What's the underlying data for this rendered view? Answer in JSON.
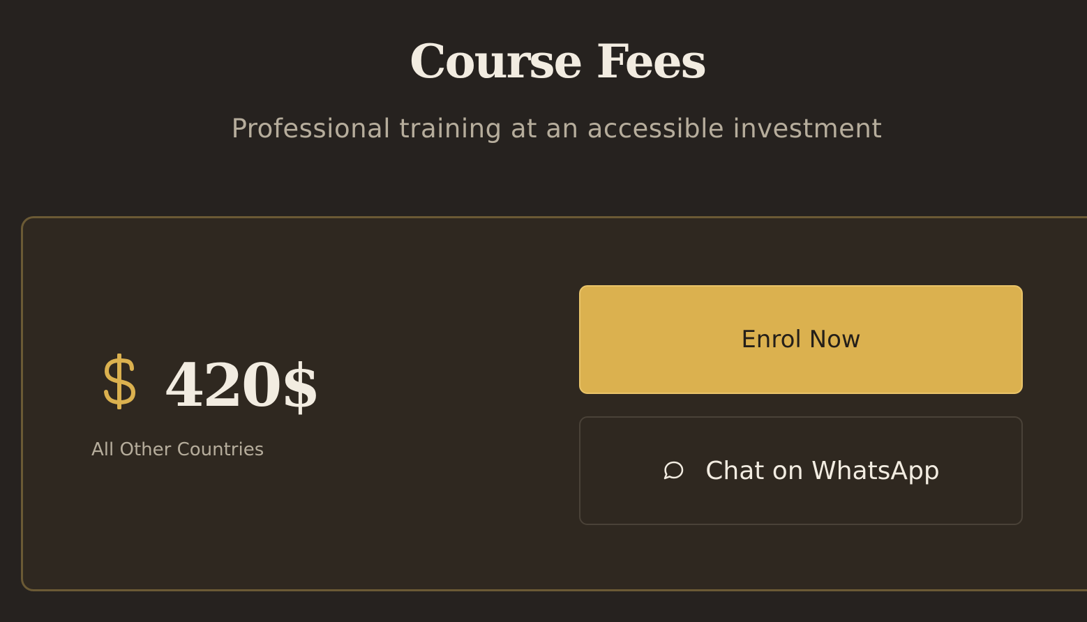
{
  "header": {
    "title": "Course Fees",
    "subtitle": "Professional training at an accessible investment"
  },
  "fee_card": {
    "price": "420$",
    "region": "All Other Countries",
    "currency_icon": "dollar-icon",
    "enrol_button": "Enrol Now",
    "whatsapp_button": "Chat on WhatsApp",
    "whatsapp_icon": "chat-bubble-icon"
  },
  "colors": {
    "background": "#26221f",
    "card_background": "#2f2820",
    "card_border": "#6b5a35",
    "accent_gold": "#dbb14f",
    "heading_text": "#f2ece1",
    "muted_text": "#b6ad9c"
  }
}
